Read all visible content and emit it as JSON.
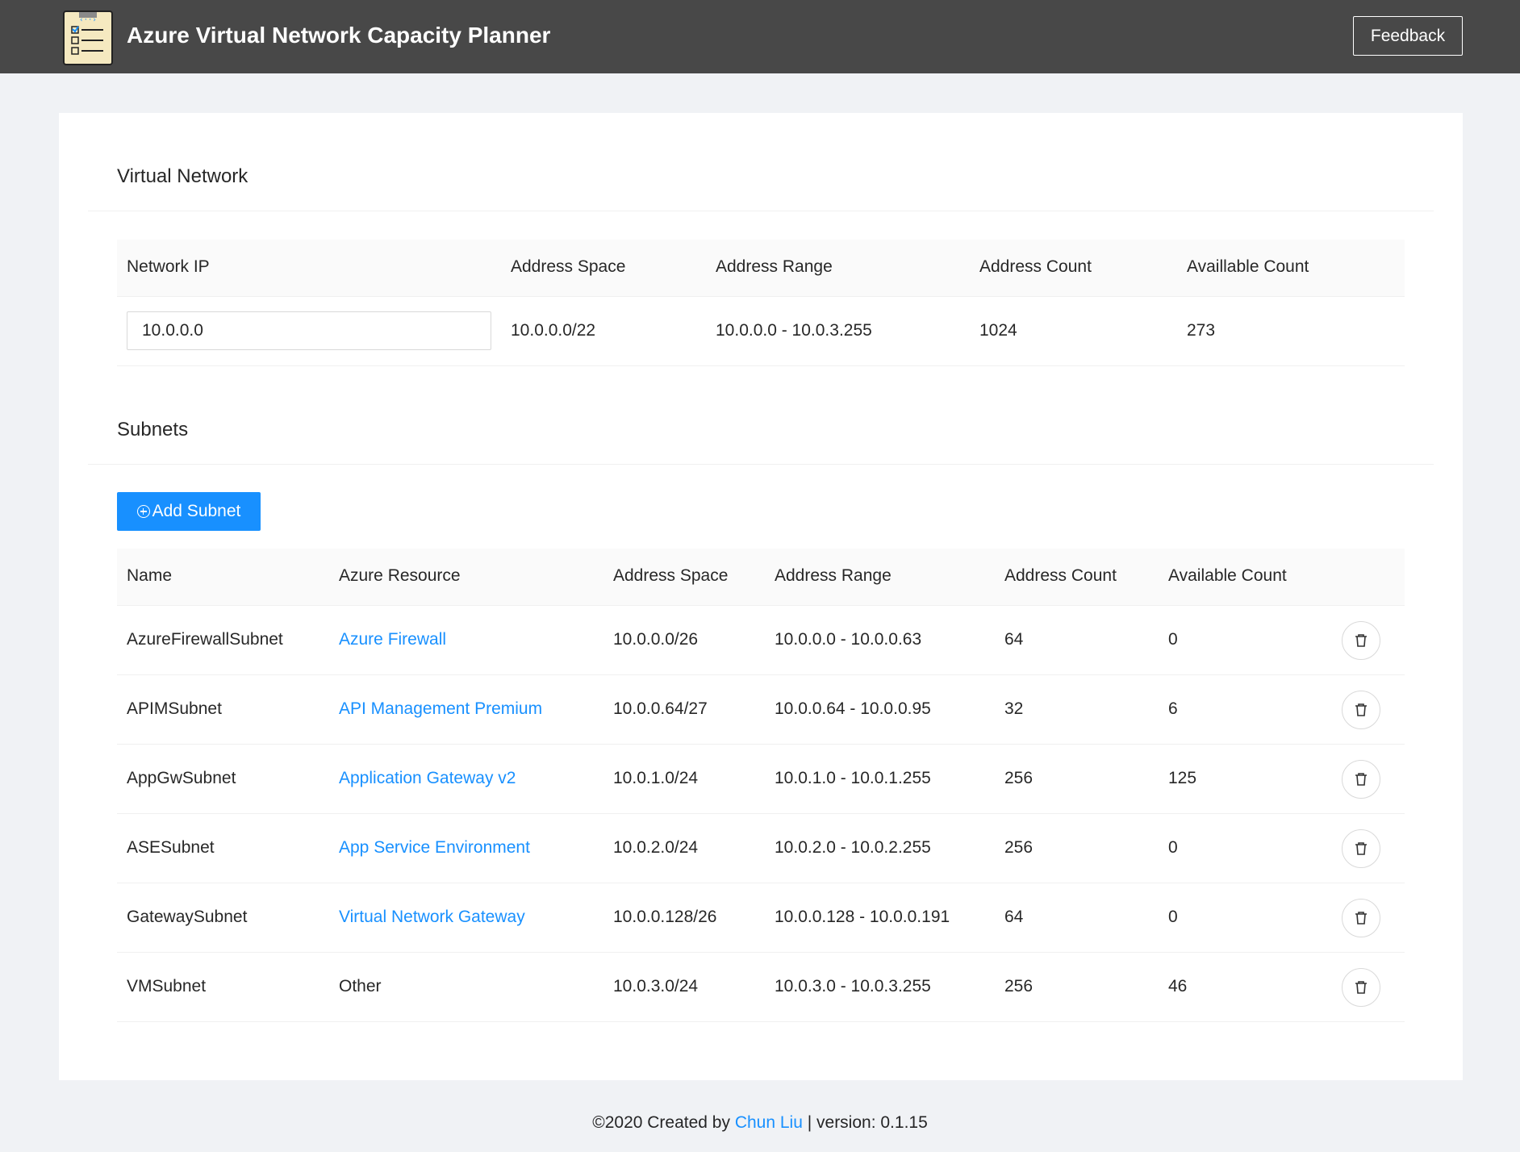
{
  "header": {
    "title": "Azure Virtual Network Capacity Planner",
    "feedback_label": "Feedback"
  },
  "vnet": {
    "section_title": "Virtual Network",
    "columns": [
      "Network IP",
      "Address Space",
      "Address Range",
      "Address Count",
      "Availlable Count"
    ],
    "network_ip": "10.0.0.0",
    "address_space": "10.0.0.0/22",
    "address_range": "10.0.0.0 - 10.0.3.255",
    "address_count": "1024",
    "available_count": "273"
  },
  "subnets": {
    "section_title": "Subnets",
    "add_label": "Add Subnet",
    "columns": [
      "Name",
      "Azure Resource",
      "Address Space",
      "Address Range",
      "Address Count",
      "Available Count"
    ],
    "rows": [
      {
        "name": "AzureFirewallSubnet",
        "resource": "Azure Firewall",
        "space": "10.0.0.0/26",
        "range": "10.0.0.0 - 10.0.0.63",
        "count": "64",
        "available": "0"
      },
      {
        "name": "APIMSubnet",
        "resource": "API Management Premium",
        "space": "10.0.0.64/27",
        "range": "10.0.0.64 - 10.0.0.95",
        "count": "32",
        "available": "6"
      },
      {
        "name": "AppGwSubnet",
        "resource": "Application Gateway v2",
        "space": "10.0.1.0/24",
        "range": "10.0.1.0 - 10.0.1.255",
        "count": "256",
        "available": "125"
      },
      {
        "name": "ASESubnet",
        "resource": "App Service Environment",
        "space": "10.0.2.0/24",
        "range": "10.0.2.0 - 10.0.2.255",
        "count": "256",
        "available": "0"
      },
      {
        "name": "GatewaySubnet",
        "resource": "Virtual Network Gateway",
        "space": "10.0.0.128/26",
        "range": "10.0.0.128 - 10.0.0.191",
        "count": "64",
        "available": "0"
      },
      {
        "name": "VMSubnet",
        "resource": "Other",
        "space": "10.0.3.0/24",
        "range": "10.0.3.0 - 10.0.3.255",
        "count": "256",
        "available": "46"
      }
    ]
  },
  "footer": {
    "prefix": "©2020 Created by ",
    "author": "Chun Liu",
    "suffix": " | version: 0.1.15"
  },
  "colors": {
    "header_bg": "#484848",
    "accent": "#1890ff",
    "page_bg": "#f0f2f5"
  },
  "icons": {
    "logo": "checklist-network-icon",
    "add": "plus-circle-icon",
    "delete": "trash-icon"
  }
}
